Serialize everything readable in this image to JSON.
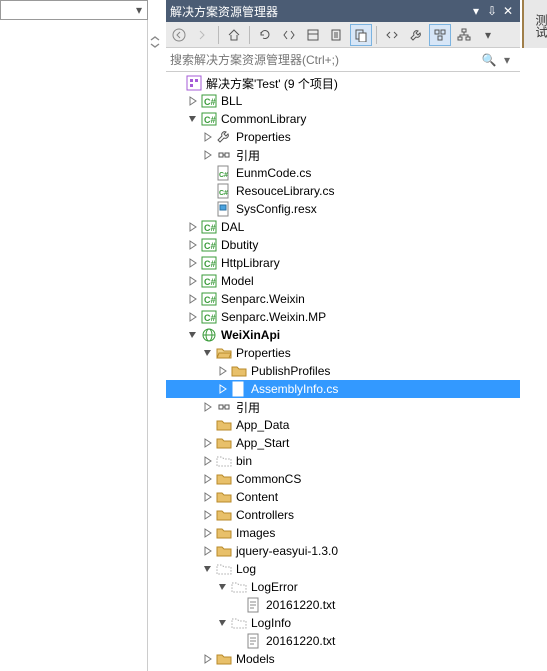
{
  "titlebar": {
    "title": "解决方案资源管理器"
  },
  "search": {
    "placeholder": "搜索解决方案资源管理器(Ctrl+;)"
  },
  "side_tab": {
    "label": "测试"
  },
  "toolbar": {
    "back": "◄",
    "forward": "►",
    "home": "⌂",
    "refresh": "↻",
    "collapse": "⇆",
    "props": "⧉",
    "show": "🗎",
    "files": "🗐",
    "code": "<>",
    "wrench": "🔧",
    "class": "⊞",
    "hier": "⧈"
  },
  "tree": [
    {
      "d": 0,
      "e": "",
      "t": "sln",
      "l": "解决方案'Test' (9 个项目)"
    },
    {
      "d": 1,
      "e": "c",
      "t": "cs",
      "l": "BLL"
    },
    {
      "d": 1,
      "e": "o",
      "t": "cs",
      "l": "CommonLibrary"
    },
    {
      "d": 2,
      "e": "c",
      "t": "wrench",
      "l": "Properties"
    },
    {
      "d": 2,
      "e": "c",
      "t": "ref",
      "l": "引用"
    },
    {
      "d": 2,
      "e": "",
      "t": "csfile",
      "l": "EunmCode.cs"
    },
    {
      "d": 2,
      "e": "",
      "t": "csfile",
      "l": "ResouceLibrary.cs"
    },
    {
      "d": 2,
      "e": "",
      "t": "resx",
      "l": "SysConfig.resx"
    },
    {
      "d": 1,
      "e": "c",
      "t": "cs",
      "l": "DAL"
    },
    {
      "d": 1,
      "e": "c",
      "t": "cs",
      "l": "Dbutity"
    },
    {
      "d": 1,
      "e": "c",
      "t": "cs",
      "l": "HttpLibrary"
    },
    {
      "d": 1,
      "e": "c",
      "t": "cs",
      "l": "Model"
    },
    {
      "d": 1,
      "e": "c",
      "t": "cs",
      "l": "Senparc.Weixin"
    },
    {
      "d": 1,
      "e": "c",
      "t": "cs",
      "l": "Senparc.Weixin.MP"
    },
    {
      "d": 1,
      "e": "o",
      "t": "web",
      "l": "WeiXinApi",
      "b": true
    },
    {
      "d": 2,
      "e": "o",
      "t": "folder-o",
      "l": "Properties"
    },
    {
      "d": 3,
      "e": "c",
      "t": "folder",
      "l": "PublishProfiles"
    },
    {
      "d": 3,
      "e": "c",
      "t": "csfile",
      "l": "AssemblyInfo.cs",
      "sel": true
    },
    {
      "d": 2,
      "e": "c",
      "t": "ref",
      "l": "引用"
    },
    {
      "d": 2,
      "e": "",
      "t": "folder",
      "l": "App_Data"
    },
    {
      "d": 2,
      "e": "c",
      "t": "folder",
      "l": "App_Start"
    },
    {
      "d": 2,
      "e": "c",
      "t": "ghost",
      "l": "bin"
    },
    {
      "d": 2,
      "e": "c",
      "t": "folder",
      "l": "CommonCS"
    },
    {
      "d": 2,
      "e": "c",
      "t": "folder",
      "l": "Content"
    },
    {
      "d": 2,
      "e": "c",
      "t": "folder",
      "l": "Controllers"
    },
    {
      "d": 2,
      "e": "c",
      "t": "folder",
      "l": "Images"
    },
    {
      "d": 2,
      "e": "c",
      "t": "folder",
      "l": "jquery-easyui-1.3.0"
    },
    {
      "d": 2,
      "e": "o",
      "t": "ghost",
      "l": "Log"
    },
    {
      "d": 3,
      "e": "o",
      "t": "ghost",
      "l": "LogError"
    },
    {
      "d": 4,
      "e": "",
      "t": "txt",
      "l": "20161220.txt"
    },
    {
      "d": 3,
      "e": "o",
      "t": "ghost",
      "l": "LogInfo"
    },
    {
      "d": 4,
      "e": "",
      "t": "txt",
      "l": "20161220.txt"
    },
    {
      "d": 2,
      "e": "c",
      "t": "folder",
      "l": "Models"
    }
  ]
}
